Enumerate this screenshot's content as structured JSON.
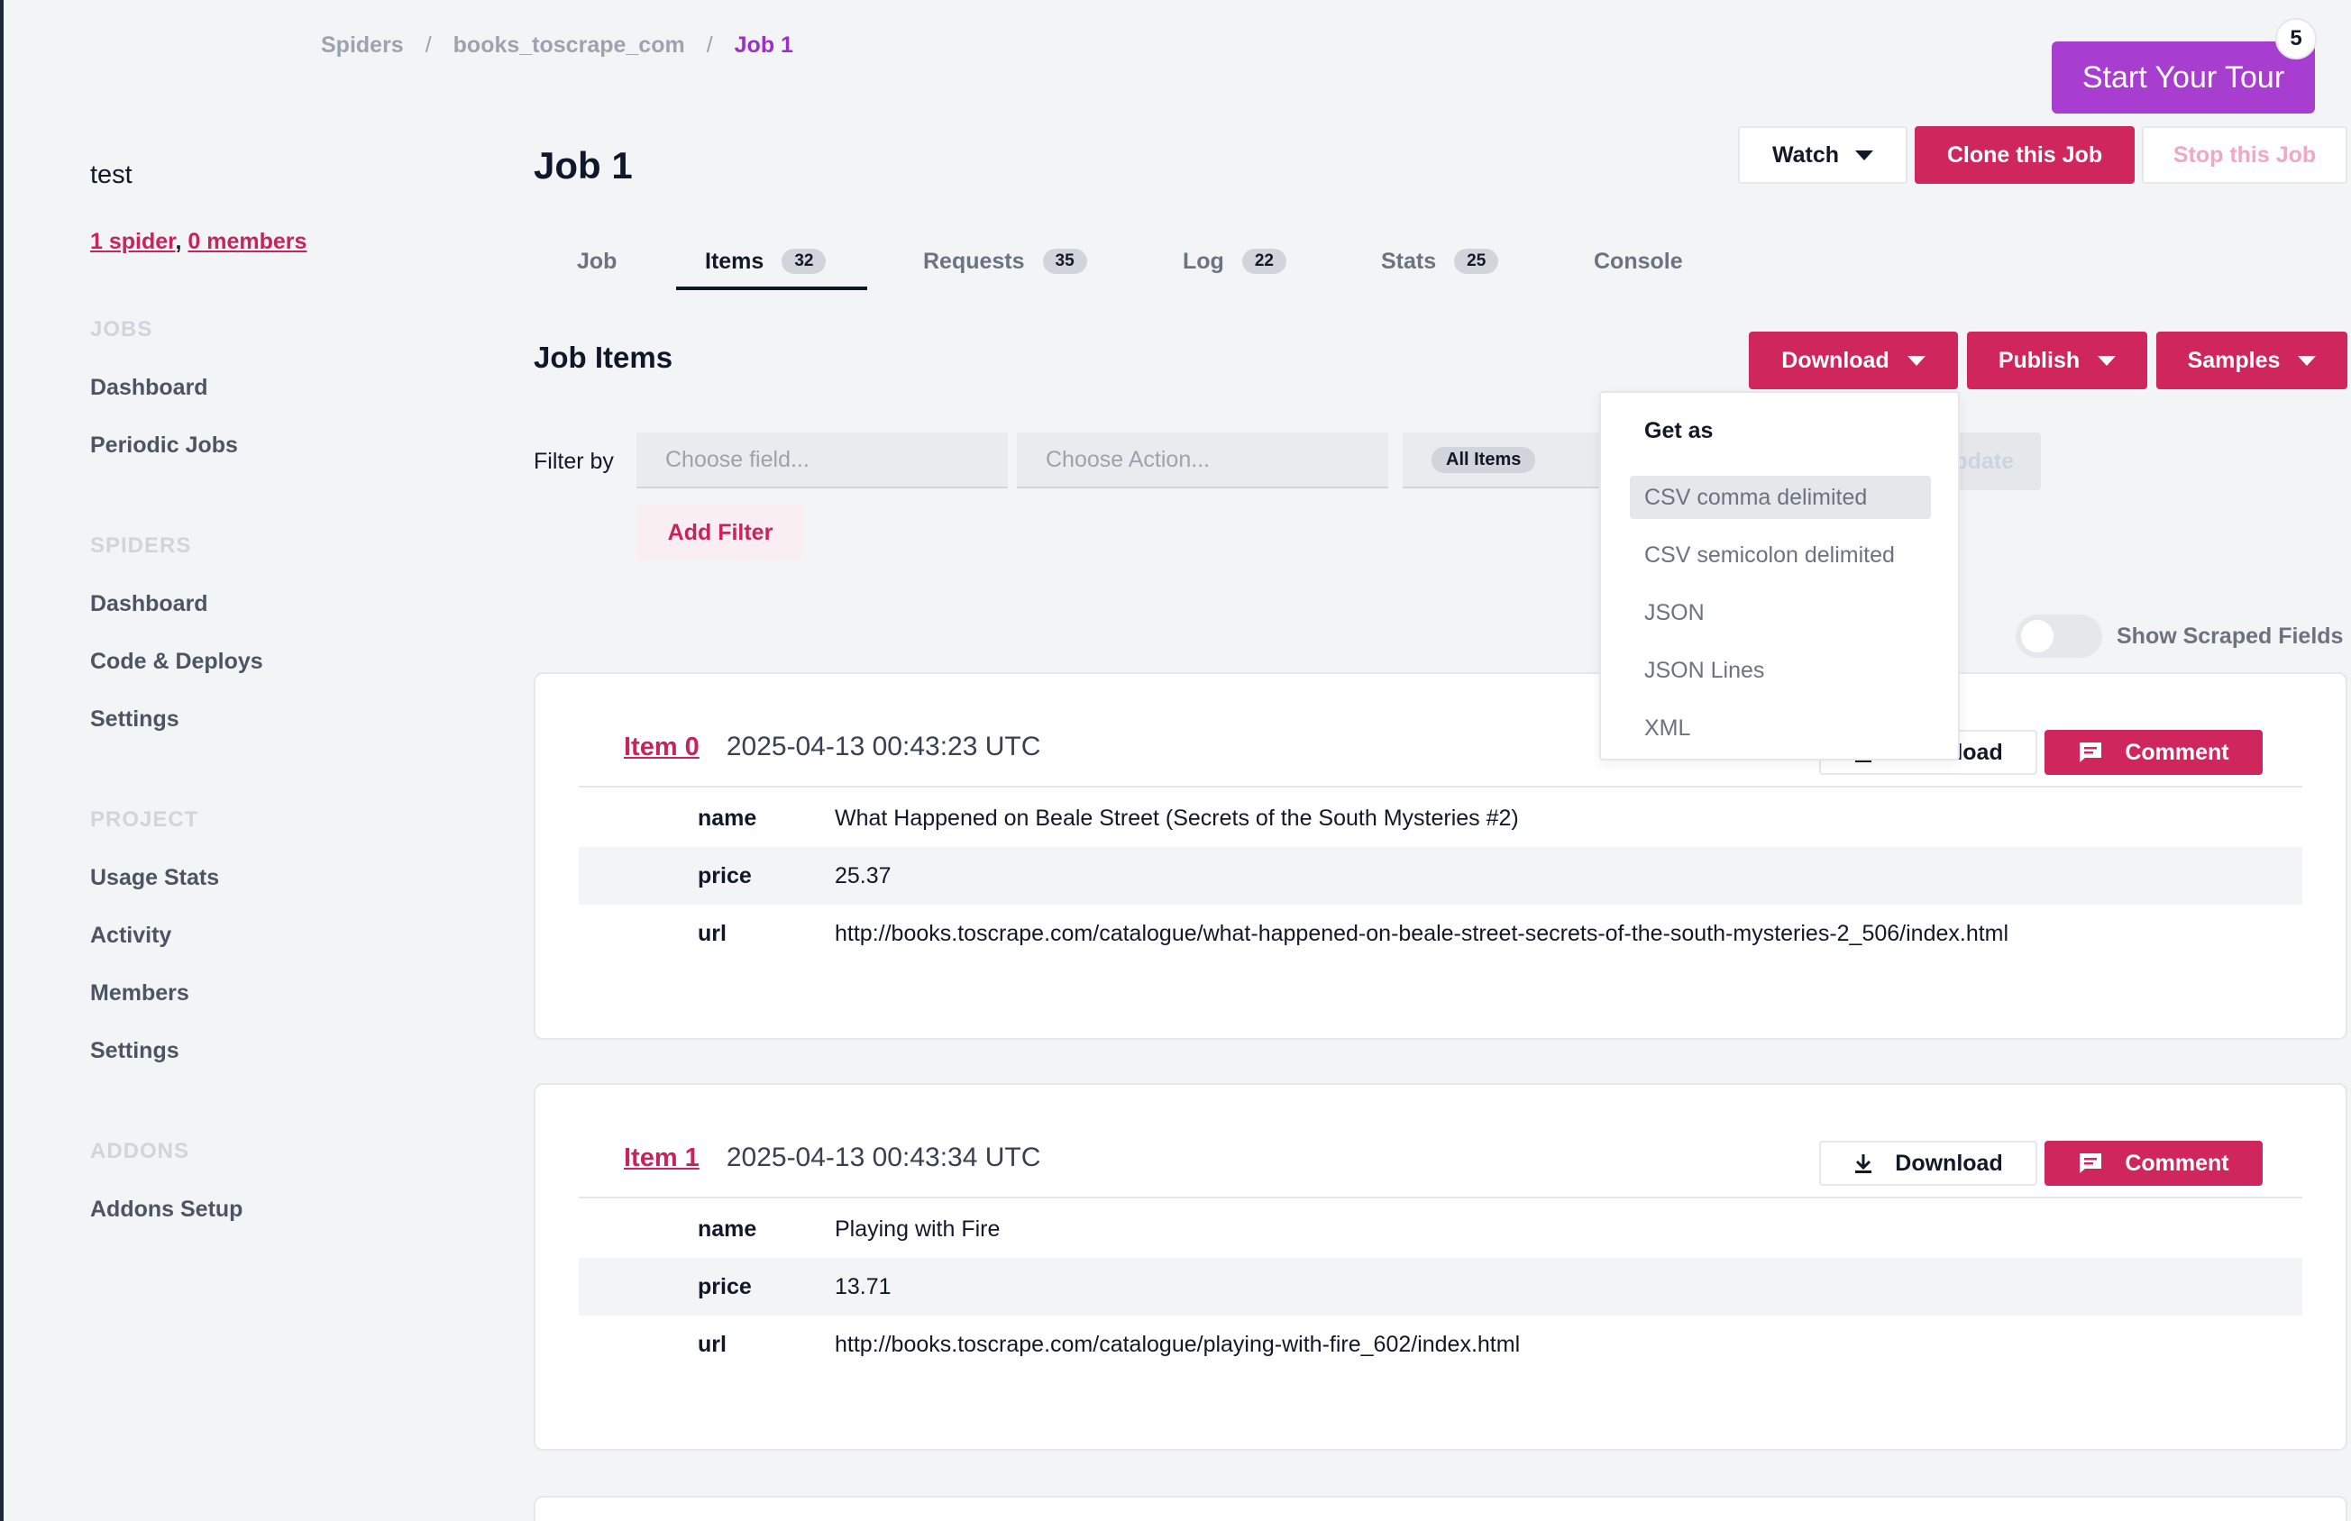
{
  "breadcrumb": [
    "Spiders",
    "books_toscrape_com",
    "Job 1"
  ],
  "breadcrumb_sep": "/",
  "tour": {
    "label": "Start Your Tour",
    "badge": "5"
  },
  "sidebar": {
    "org_name": "test",
    "spiders_link": "1 spider",
    "comma": ",",
    "members_link": "0 members",
    "sections": [
      {
        "title": "JOBS",
        "items": [
          "Dashboard",
          "Periodic Jobs"
        ]
      },
      {
        "title": "SPIDERS",
        "items": [
          "Dashboard",
          "Code & Deploys",
          "Settings"
        ]
      },
      {
        "title": "PROJECT",
        "items": [
          "Usage Stats",
          "Activity",
          "Members",
          "Settings"
        ]
      },
      {
        "title": "ADDONS",
        "items": [
          "Addons Setup"
        ]
      }
    ]
  },
  "header": {
    "title": "Job 1",
    "watch": "Watch",
    "clone": "Clone this Job",
    "stop": "Stop this Job"
  },
  "tabs": [
    {
      "label": "Job",
      "count": ""
    },
    {
      "label": "Items",
      "count": "32",
      "active": true
    },
    {
      "label": "Requests",
      "count": "35"
    },
    {
      "label": "Log",
      "count": "22"
    },
    {
      "label": "Stats",
      "count": "25"
    },
    {
      "label": "Console",
      "count": ""
    }
  ],
  "items_section": {
    "title": "Job Items",
    "download": "Download",
    "publish": "Publish",
    "samples": "Samples"
  },
  "filters": {
    "label": "Filter by",
    "field_placeholder": "Choose field...",
    "action_placeholder": "Choose Action...",
    "all_items": "All Items",
    "update": "Update",
    "add_filter": "Add Filter"
  },
  "toggle": {
    "label": "Show Scraped Fields",
    "on": false
  },
  "download_menu": {
    "title": "Get as",
    "options": [
      "CSV comma delimited",
      "CSV semicolon delimited",
      "JSON",
      "JSON Lines",
      "XML"
    ],
    "highlighted": 0
  },
  "items": [
    {
      "label": "Item 0",
      "timestamp": "2025-04-13 00:43:23 UTC",
      "download": "Download",
      "comment": "Comment",
      "fields": [
        {
          "key": "name",
          "value": "What Happened on Beale Street (Secrets of the South Mysteries #2)"
        },
        {
          "key": "price",
          "value": "25.37"
        },
        {
          "key": "url",
          "value": "http://books.toscrape.com/catalogue/what-happened-on-beale-street-secrets-of-the-south-mysteries-2_506/index.html"
        }
      ]
    },
    {
      "label": "Item 1",
      "timestamp": "2025-04-13 00:43:34 UTC",
      "download": "Download",
      "comment": "Comment",
      "fields": [
        {
          "key": "name",
          "value": "Playing with Fire"
        },
        {
          "key": "price",
          "value": "13.71"
        },
        {
          "key": "url",
          "value": "http://books.toscrape.com/catalogue/playing-with-fire_602/index.html"
        }
      ]
    }
  ],
  "colors": {
    "accent": "#d0265e",
    "tour": "#a83ecf",
    "breadcrumb_active": "#9b30c9"
  }
}
